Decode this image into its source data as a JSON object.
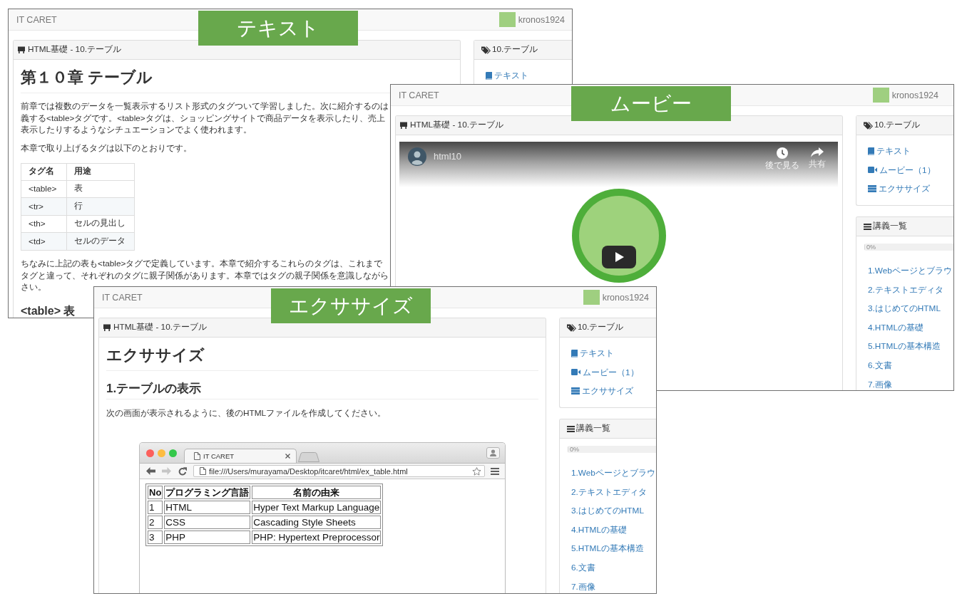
{
  "windows": [
    {
      "kind": "text",
      "badge": "テキスト",
      "navbar": {
        "brand": "IT CARET",
        "username": "kronos1924"
      },
      "breadcrumb": "HTML基礎 - 10.テーブル",
      "chapter": {
        "title": "第１０章 テーブル",
        "intro_lines": [
          "前章では複数のデータを一覧表示するリスト形式のタグついて学習しました。次に紹介するのは",
          "義する<table>タグです。<table>タグは、ショッピングサイトで商品データを表示したり、売上",
          "表示したりするようなシチュエーションでよく使われます。"
        ],
        "lead": "本章で取り上げるタグは以下のとおりです。",
        "table": {
          "columns": [
            "タグ名",
            "用途"
          ],
          "rows": [
            [
              "<table>",
              "表"
            ],
            [
              "<tr>",
              "行"
            ],
            [
              "<th>",
              "セルの見出し"
            ],
            [
              "<td>",
              "セルのデータ"
            ]
          ]
        },
        "note_lines": [
          "ちなみに上記の表も<table>タグで定義しています。本章で紹介するこれらのタグは、これまで",
          "タグと違って、それぞれのタグに親子関係があります。本章ではタグの親子関係を意識しながら",
          "さい。"
        ],
        "subheading": "<table> 表"
      },
      "sidebar": {
        "title": "10.テーブル",
        "links": [
          {
            "kind": "text",
            "label": "テキスト"
          }
        ]
      }
    },
    {
      "kind": "movie",
      "badge": "ムービー",
      "navbar": {
        "brand": "IT CARET",
        "username": "kronos1924"
      },
      "breadcrumb": "HTML基礎 - 10.テーブル",
      "video": {
        "channel": "html10",
        "actions": [
          {
            "kind": "watch_later",
            "label": "後で見る"
          },
          {
            "kind": "share",
            "label": "共有"
          }
        ]
      },
      "sidebar": {
        "title": "10.テーブル",
        "links": [
          {
            "kind": "text",
            "label": "テキスト"
          },
          {
            "kind": "movie",
            "label": "ムービー（1）"
          },
          {
            "kind": "exercise",
            "label": "エクササイズ"
          }
        ],
        "lectures": {
          "title": "講義一覧",
          "progress": {
            "level": 0,
            "reading": "0%"
          },
          "items": [
            "1.Webページとブラウ",
            "2.テキストエディタ",
            "3.はじめてのHTML",
            "4.HTMLの基礎",
            "5.HTMLの基本構造",
            "6.文書",
            "7.画像"
          ]
        }
      }
    },
    {
      "kind": "exercise",
      "badge": "エクササイズ",
      "navbar": {
        "brand": "IT CARET",
        "username": "kronos1924"
      },
      "breadcrumb": "HTML基礎 - 10.テーブル",
      "exercise": {
        "title": "エクササイズ",
        "heading": "1.テーブルの表示",
        "instruction": "次の画面が表示されるように、後のHTMLファイルを作成してください。",
        "browser": {
          "tab_title": "IT CARET",
          "url": "file:///Users/murayama/Desktop/itcaret/html/ex_table.html",
          "table": {
            "columns": [
              "No",
              "プログラミング言語",
              "名前の由来"
            ],
            "rows": [
              [
                "1",
                "HTML",
                "Hyper Text Markup Language"
              ],
              [
                "2",
                "CSS",
                "Cascading Style Sheets"
              ],
              [
                "3",
                "PHP",
                "PHP: Hypertext Preprocessor"
              ]
            ]
          }
        }
      },
      "sidebar": {
        "title": "10.テーブル",
        "links": [
          {
            "kind": "text",
            "label": "テキスト"
          },
          {
            "kind": "movie",
            "label": "ムービー（1）"
          },
          {
            "kind": "exercise",
            "label": "エクササイズ"
          }
        ],
        "lectures": {
          "title": "講義一覧",
          "progress": {
            "level": 0,
            "reading": "0%"
          },
          "items": [
            "1.Webページとブラウ",
            "2.テキストエディタ",
            "3.はじめてのHTML",
            "4.HTMLの基礎",
            "5.HTMLの基本構造",
            "6.文書",
            "7.画像"
          ]
        }
      }
    }
  ]
}
